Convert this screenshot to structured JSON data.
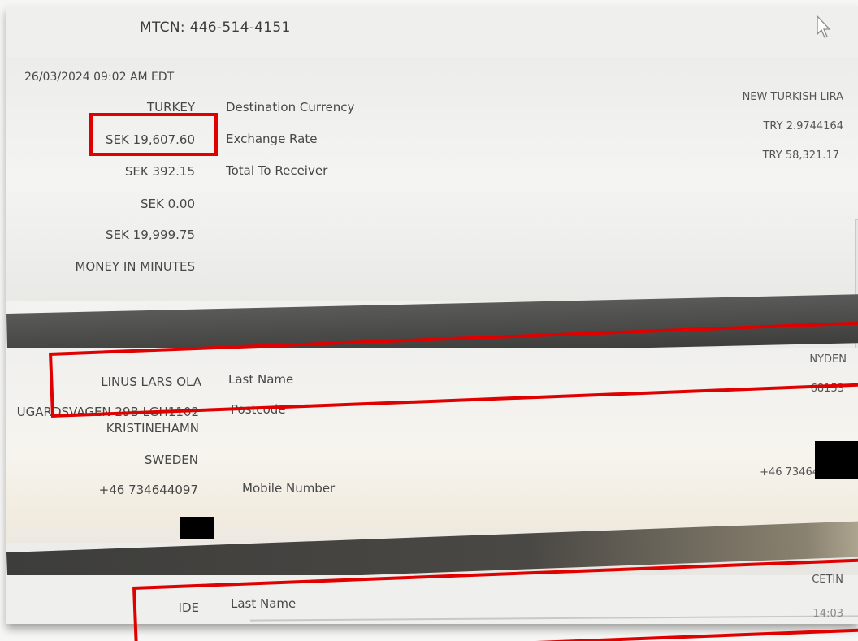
{
  "header": {
    "mtcn": "MTCN: 446-514-4151"
  },
  "transaction": {
    "datetime": "26/03/2024 09:02 AM EDT",
    "country": "TURKEY",
    "send_amount": "SEK 19,607.60",
    "fee": "SEK 392.15",
    "discount": "SEK 0.00",
    "total": "SEK 19,999.75",
    "service": "MONEY IN MINUTES",
    "labels": {
      "destination_currency": "Destination Currency",
      "exchange_rate": "Exchange Rate",
      "total_to_receiver": "Total To Receiver"
    },
    "values": {
      "destination_currency": "NEW TURKISH LIRA",
      "exchange_rate": "TRY 2.9744164",
      "total_to_receiver": "TRY 58,321.17"
    }
  },
  "sender": {
    "first_names": "LINUS LARS OLA",
    "address": "UGARDSVAGEN 29B LGH1102",
    "city": "KRISTINEHAMN",
    "country": "SWEDEN",
    "phone": "+46 734644097",
    "labels": {
      "last_name": "Last Name",
      "postcode": "Postcode",
      "mobile_number": "Mobile Number"
    },
    "values": {
      "last_name": "NYDEN",
      "postcode": "68153",
      "mobile_number": "+46 73464"
    }
  },
  "receiver": {
    "first_name": "IDE",
    "labels": {
      "last_name": "Last Name"
    },
    "values": {
      "last_name": "CETIN",
      "time": "14:03"
    }
  },
  "icons": {
    "cursor": "mouse-pointer-icon",
    "side_tab": "chevron-left-icon"
  },
  "colors": {
    "highlight": "#e00000",
    "band": "#3e3e3c"
  }
}
